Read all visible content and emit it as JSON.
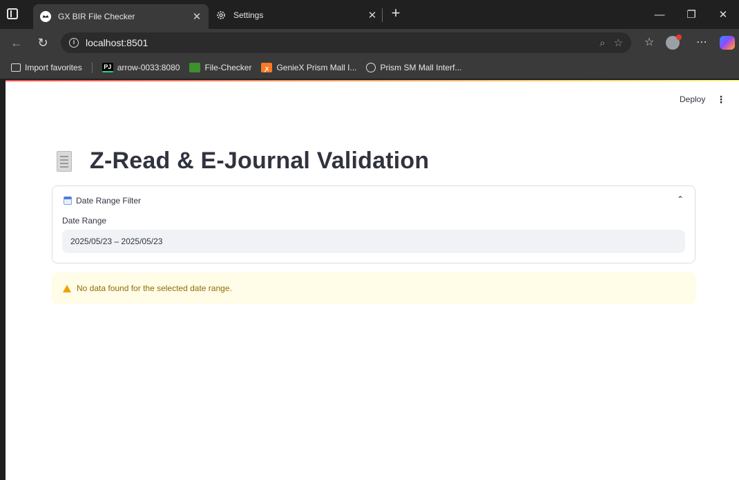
{
  "browser": {
    "tabs": [
      {
        "title": "GX BIR File Checker",
        "icon": "streamlit-crown-icon",
        "active": true
      },
      {
        "title": "Settings",
        "icon": "gear-icon",
        "active": false
      }
    ],
    "address": "localhost:8501",
    "favorites": [
      {
        "label": "Import favorites",
        "icon": "import-icon"
      },
      {
        "label": "arrow-0033:8080",
        "icon": "pycharm-icon"
      },
      {
        "label": "File-Checker",
        "icon": "folder-icon"
      },
      {
        "label": "GenieX Prism Mall I...",
        "icon": "xampp-icon"
      },
      {
        "label": "Prism SM Mall Interf...",
        "icon": "globe-icon"
      }
    ]
  },
  "app": {
    "header": {
      "deploy_label": "Deploy"
    },
    "title": "Z-Read & E-Journal Validation",
    "title_icon": "scroll-icon",
    "filter": {
      "header": "Date Range Filter",
      "header_icon": "calendar-icon",
      "expanded": true,
      "date_label": "Date Range",
      "date_value": "2025/05/23 – 2025/05/23"
    },
    "warning": {
      "text": "No data found for the selected date range.",
      "icon": "warning-icon"
    }
  },
  "colors": {
    "text": "#31333f",
    "input_bg": "#f0f2f6",
    "warning_bg": "#fffce7",
    "warning_text": "#926c05",
    "browser_dark": "#202020"
  }
}
